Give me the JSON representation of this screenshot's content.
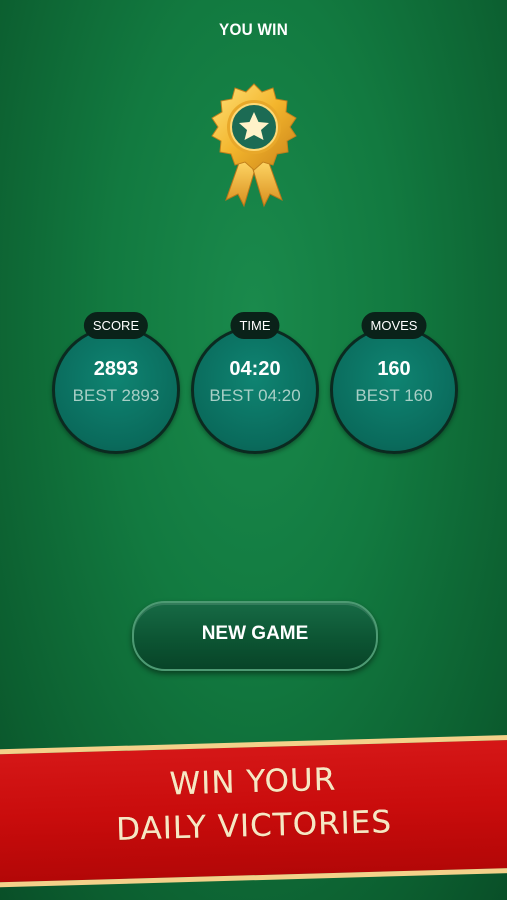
{
  "header": {
    "title": "YOU WIN"
  },
  "medal": {
    "icon": "star-medal-icon"
  },
  "stats": [
    {
      "label": "SCORE",
      "value": "2893",
      "best": "BEST 2893"
    },
    {
      "label": "TIME",
      "value": "04:20",
      "best": "BEST 04:20"
    },
    {
      "label": "MOVES",
      "value": "160",
      "best": "BEST 160"
    }
  ],
  "new_game_button": {
    "label": "NEW GAME"
  },
  "banner": {
    "line1": "WIN YOUR",
    "line2": "DAILY VICTORIES"
  },
  "colors": {
    "background": "#127a40",
    "stat_circle": "#0a6b5c",
    "banner": "#c90c0c",
    "gold": "#f2b52d"
  }
}
